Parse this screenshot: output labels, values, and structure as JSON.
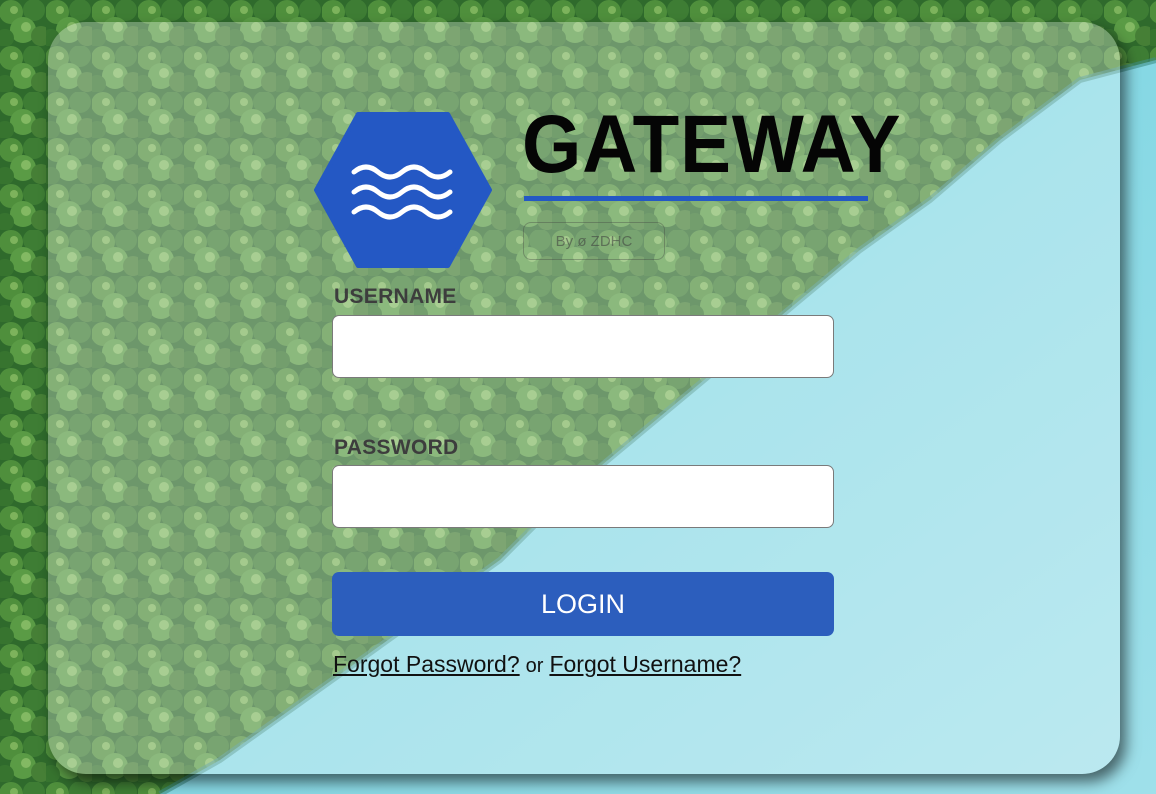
{
  "brand": {
    "wordmark": "GATEWAY",
    "byline": "By ø ZDHC",
    "logo_icon": "waves-icon",
    "hex_color": "#2458c4"
  },
  "form": {
    "username_label": "USERNAME",
    "username_value": "",
    "password_label": "PASSWORD",
    "password_value": "",
    "login_label": "LOGIN"
  },
  "links": {
    "forgot_password": "Forgot Password?",
    "separator": "or",
    "forgot_username": "Forgot Username?"
  },
  "colors": {
    "accent": "#2c5ebd",
    "forest": "#3f7a35",
    "water": "#7fd3e0"
  }
}
